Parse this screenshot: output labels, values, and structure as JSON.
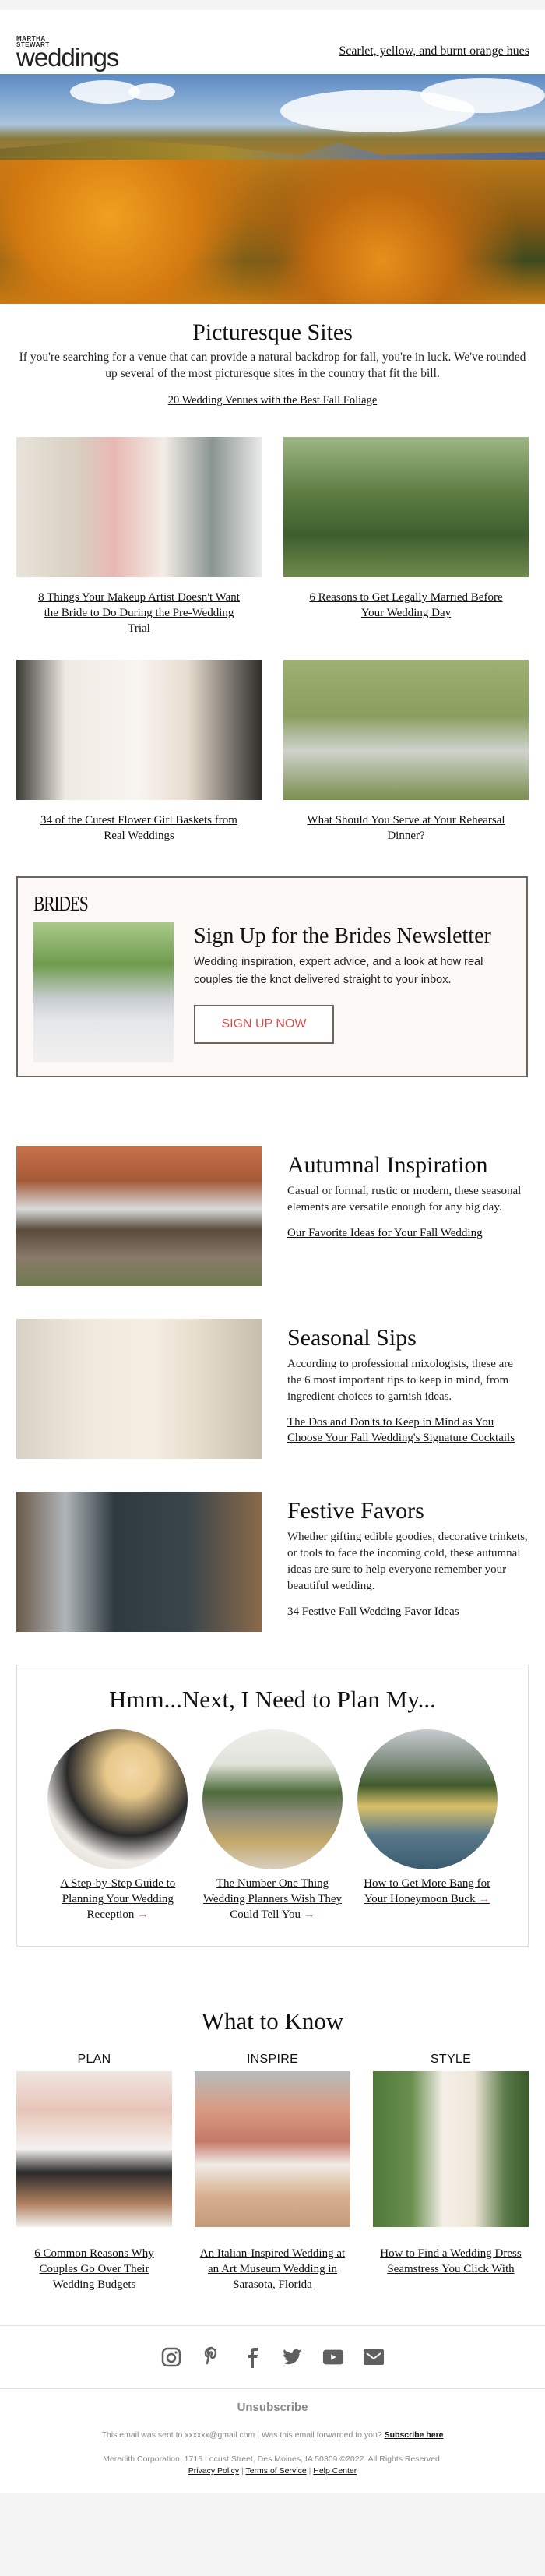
{
  "header": {
    "logo_small_1": "MARTHA",
    "logo_small_2": "STEWART",
    "logo_big": "weddings",
    "tagline_link": "Scarlet, yellow, and burnt orange hues"
  },
  "hero": {
    "image": "autumn-mountain-foliage-photo"
  },
  "intro": {
    "title": "Picturesque Sites",
    "body": "If you're searching for a venue that can provide a natural backdrop for fall, you're in luck. We've rounded up several of the most picturesque sites in the country that fit the bill.",
    "link": "20 Wedding Venues with the Best Fall Foliage"
  },
  "articles": [
    {
      "title": "8 Things Your Makeup Artist Doesn't Want the Bride to Do During the Pre-Wedding Trial",
      "image": "makeup-trial-photo"
    },
    {
      "title": "6 Reasons to Get Legally Married Before Your Wedding Day",
      "image": "garden-ceremony-photo"
    },
    {
      "title": "34 of the Cutest Flower Girl Baskets from Real Weddings",
      "image": "flower-girls-photo"
    },
    {
      "title": "What Should You Serve at Your Rehearsal Dinner?",
      "image": "outdoor-grill-photo"
    }
  ],
  "brides_promo": {
    "brand": "BRIDES",
    "title": "Sign Up for the Brides Newsletter",
    "body": "Wedding inspiration, expert advice, and a look at how real couples tie the knot delivered straight to your inbox.",
    "button": "SIGN UP NOW",
    "image": "floral-arch-photo"
  },
  "features": [
    {
      "title": "Autumnal Inspiration",
      "body": "Casual or formal, rustic or modern, these seasonal elements are versatile enough for any big day.",
      "link": "Our Favorite Ideas for Your Fall Wedding",
      "image": "couple-autumn-fence-photo"
    },
    {
      "title": "Seasonal Sips",
      "body": "According to professional mixologists, these are the 6 most important tips to keep in mind, from ingredient choices to garnish ideas.",
      "link": "The Dos and Don'ts to Keep in Mind as You Choose Your Fall Wedding's Signature Cocktails",
      "image": "cocktail-menu-photo"
    },
    {
      "title": "Festive Favors",
      "body": "Whether gifting edible goodies, decorative trinkets, or tools to face the incoming cold, these autumnal ideas are sure to help everyone remember your beautiful wedding.",
      "link": "34 Festive Fall Wedding Favor Ideas",
      "image": "homebrew-chalkboard-photo"
    }
  ],
  "plan": {
    "title": "Hmm...Next, I Need to Plan My...",
    "arrow": "→",
    "items": [
      {
        "title": "A Step-by-Step Guide to Planning Your Wedding Reception",
        "image": "toast-photo"
      },
      {
        "title": "The Number One Thing Wedding Planners Wish They Could Tell You",
        "image": "barn-venue-photo"
      },
      {
        "title": "How to Get More Bang for Your Honeymoon Buck",
        "image": "lake-hotel-photo"
      }
    ]
  },
  "what_to_know": {
    "title": "What to Know",
    "items": [
      {
        "label": "PLAN",
        "title": "6 Common Reasons Why Couples Go Over Their Wedding Budgets",
        "image": "cake-topper-coins-photo"
      },
      {
        "label": "INSPIRE",
        "title": "An Italian-Inspired Wedding at an Art Museum Wedding in Sarasota, Florida",
        "image": "couple-balcony-photo"
      },
      {
        "label": "STYLE",
        "title": "How to Find a Wedding Dress Seamstress You Click With",
        "image": "bride-bouquet-photo"
      }
    ]
  },
  "social": [
    "instagram-icon",
    "pinterest-icon",
    "facebook-icon",
    "twitter-icon",
    "youtube-icon",
    "email-icon"
  ],
  "footer": {
    "unsubscribe": "Unsubscribe",
    "sent_to": "This email was sent to xxxxxx@gmail.com  |  Was this email forwarded to you?",
    "subscribe_link": "Subscribe here",
    "address": "Meredith Corporation, 1716 Locust Street, Des Moines, IA 50309 ©2022. All Rights Reserved.",
    "privacy": "Privacy Policy",
    "terms": "Terms of Service",
    "help": "Help Center",
    "separator": "|"
  },
  "colors": {
    "accent_red": "#d94b4b",
    "arrow_pink": "#e37c7c",
    "promo_bg": "#fcf8f5",
    "icon_gray": "#5f5f5f"
  }
}
